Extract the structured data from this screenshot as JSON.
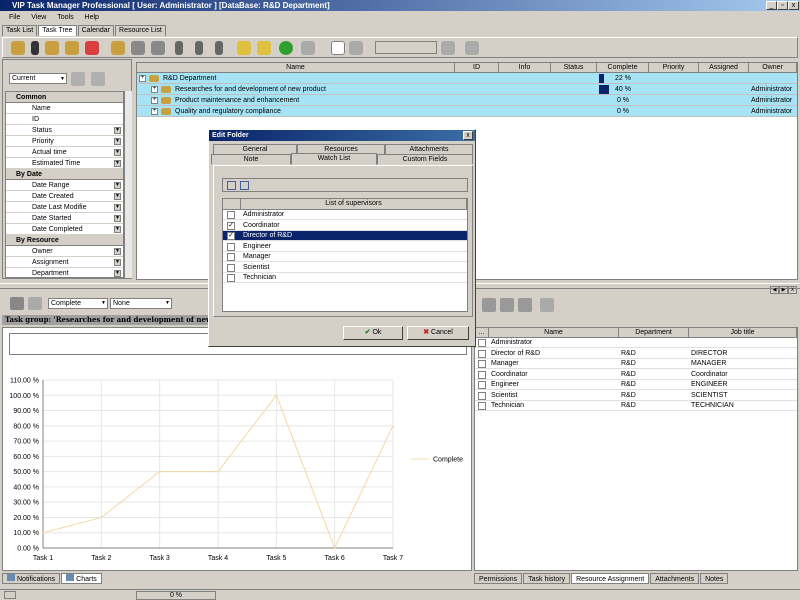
{
  "window": {
    "title": "VIP Task Manager Professional [ User: Administrator ] [DataBase: R&D Department]"
  },
  "menu": [
    "File",
    "View",
    "Tools",
    "Help"
  ],
  "main_tabs": [
    "Task List",
    "Task Tree",
    "Calendar",
    "Resource List"
  ],
  "filter": {
    "view_select": "Current",
    "sections": [
      {
        "title": "Common",
        "items": [
          {
            "label": "Name",
            "dd": false
          },
          {
            "label": "ID",
            "dd": false
          },
          {
            "label": "Status",
            "dd": true
          },
          {
            "label": "Priority",
            "dd": true
          },
          {
            "label": "Actual time",
            "dd": true
          },
          {
            "label": "Estimated Time",
            "dd": true
          }
        ]
      },
      {
        "title": "By Date",
        "items": [
          {
            "label": "Date Range",
            "dd": true
          },
          {
            "label": "Date Created",
            "dd": true
          },
          {
            "label": "Date Last Modifie",
            "dd": true
          },
          {
            "label": "Date Started",
            "dd": true
          },
          {
            "label": "Date Completed",
            "dd": true
          }
        ]
      },
      {
        "title": "By Resource",
        "items": [
          {
            "label": "Owner",
            "dd": true
          },
          {
            "label": "Assignment",
            "dd": true
          },
          {
            "label": "Department",
            "dd": true
          }
        ]
      }
    ]
  },
  "task_grid": {
    "columns": [
      "Name",
      "ID",
      "Info",
      "Status",
      "Complete",
      "Priority",
      "Assigned",
      "Owner"
    ],
    "rows": [
      {
        "name": "R&D Department",
        "complete": "22 %",
        "owner": "",
        "level": 0,
        "pct": 0.22
      },
      {
        "name": "Researches for and development of new product",
        "complete": "40 %",
        "owner": "Administrator",
        "level": 1,
        "pct": 0.4
      },
      {
        "name": "Product maintenance and enhancement",
        "complete": "0 %",
        "owner": "Administrator",
        "level": 1,
        "pct": 0
      },
      {
        "name": "Quality and regulatory compliance",
        "complete": "0 %",
        "owner": "Administrator",
        "level": 1,
        "pct": 0
      }
    ]
  },
  "chart_toolbar": {
    "select1": "Complete",
    "select2": "None"
  },
  "task_group": "Task group: 'Researches for and development of new product'",
  "chart_data": {
    "type": "line",
    "categories": [
      "Task 1",
      "Task 2",
      "Task 3",
      "Task 4",
      "Task 5",
      "Task 6",
      "Task 7"
    ],
    "series": [
      {
        "name": "Complete",
        "values": [
          10,
          20,
          50,
          50,
          100,
          0,
          80
        ]
      }
    ],
    "ylim": [
      0,
      110
    ],
    "yticks": [
      "0.00 %",
      "10.00 %",
      "20.00 %",
      "30.00 %",
      "40.00 %",
      "50.00 %",
      "60.00 %",
      "70.00 %",
      "80.00 %",
      "90.00 %",
      "100.00 %",
      "110.00 %"
    ],
    "legend": "right",
    "grid": true,
    "color": "#f5d8a0"
  },
  "bottom_left_tabs": [
    "Notifications",
    "Charts"
  ],
  "resource_grid": {
    "columns": [
      "...",
      "Name",
      "Department",
      "Job title"
    ],
    "rows": [
      {
        "name": "Administrator",
        "dept": "",
        "job": ""
      },
      {
        "name": "Director of R&D",
        "dept": "R&D",
        "job": "DIRECTOR"
      },
      {
        "name": "Manager",
        "dept": "R&D",
        "job": "MANAGER"
      },
      {
        "name": "Coordinator",
        "dept": "R&D",
        "job": "Coordinator"
      },
      {
        "name": "Engineer",
        "dept": "R&D",
        "job": "ENGINEER"
      },
      {
        "name": "Scientist",
        "dept": "R&D",
        "job": "SCIENTIST"
      },
      {
        "name": "Technician",
        "dept": "R&D",
        "job": "TECHNICIAN"
      }
    ]
  },
  "bottom_right_tabs": [
    "Permissions",
    "Task history",
    "Resource Assignment",
    "Attachments",
    "Notes"
  ],
  "status_bar": {
    "progress": "0 %"
  },
  "dialog": {
    "title": "Edit Folder",
    "tabs_row1": [
      "General",
      "Resources",
      "Attachments"
    ],
    "tabs_row2": [
      "Note",
      "Watch List",
      "Custom Fields"
    ],
    "list_header": "List of supervisors",
    "supervisors": [
      {
        "name": "Administrator",
        "checked": false,
        "selected": false
      },
      {
        "name": "Coordinator",
        "checked": true,
        "selected": false
      },
      {
        "name": "Director of R&D",
        "checked": true,
        "selected": true
      },
      {
        "name": "Engineer",
        "checked": false,
        "selected": false
      },
      {
        "name": "Manager",
        "checked": false,
        "selected": false
      },
      {
        "name": "Scientist",
        "checked": false,
        "selected": false
      },
      {
        "name": "Technician",
        "checked": false,
        "selected": false
      }
    ],
    "ok_label": "Ok",
    "cancel_label": "Cancel"
  }
}
